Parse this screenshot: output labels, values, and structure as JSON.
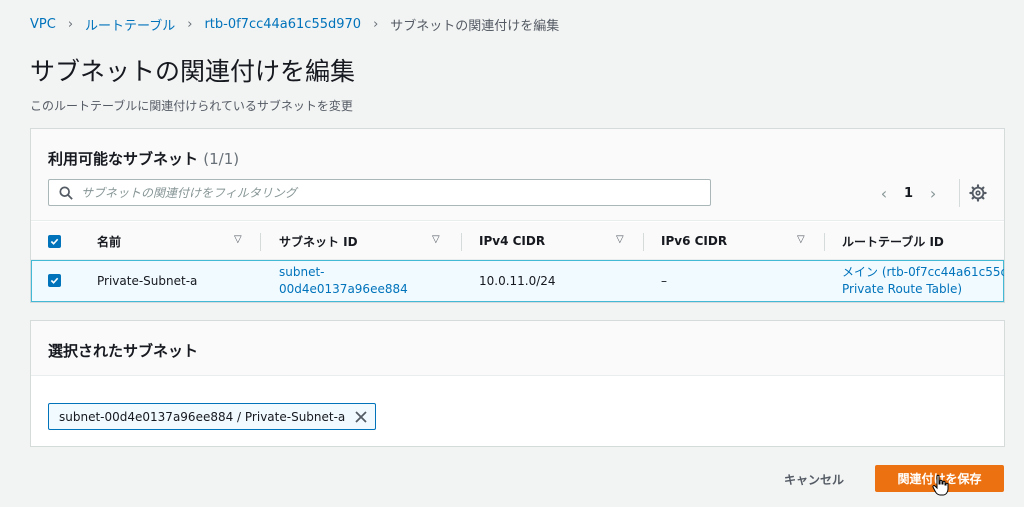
{
  "breadcrumb": {
    "items": [
      "VPC",
      "ルートテーブル",
      "rtb-0f7cc44a61c55d970"
    ],
    "current": "サブネットの関連付けを編集"
  },
  "page": {
    "title": "サブネットの関連付けを編集",
    "description": "このルートテーブルに関連付けられているサブネットを変更"
  },
  "available_subnets": {
    "title": "利用可能なサブネット",
    "count": "(1/1)",
    "filter_placeholder": "サブネットの関連付けをフィルタリング",
    "page_number": "1",
    "columns": [
      "名前",
      "サブネット ID",
      "IPv4 CIDR",
      "IPv6 CIDR",
      "ルートテーブル ID"
    ],
    "rows": [
      {
        "name": "Private-Subnet-a",
        "subnet_id_line1": "subnet-",
        "subnet_id_line2": "00d4e0137a96ee884",
        "ipv4": "10.0.11.0/24",
        "ipv6": "–",
        "route_table_line1": "メイン (rtb-0f7cc44a61c55c",
        "route_table_line2": "Private Route Table)"
      }
    ]
  },
  "selected_subnets": {
    "title": "選択されたサブネット",
    "token": "subnet-00d4e0137a96ee884 / Private-Subnet-a"
  },
  "footer": {
    "cancel_label": "キャンセル",
    "save_label": "関連付けを保存"
  },
  "colors": {
    "link": "#0073bb",
    "primary_button": "#ec7211",
    "selected_row": "#f1faff"
  }
}
